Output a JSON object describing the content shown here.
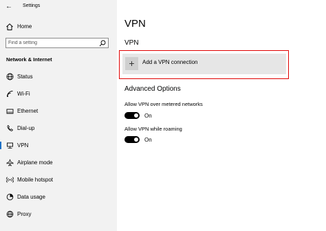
{
  "window": {
    "title": "Settings"
  },
  "sidebar": {
    "home_label": "Home",
    "search": {
      "placeholder": "Find a setting"
    },
    "section_title": "Network & Internet",
    "items": [
      {
        "label": "Status"
      },
      {
        "label": "Wi-Fi"
      },
      {
        "label": "Ethernet"
      },
      {
        "label": "Dial-up"
      },
      {
        "label": "VPN"
      },
      {
        "label": "Airplane mode"
      },
      {
        "label": "Mobile hotspot"
      },
      {
        "label": "Data usage"
      },
      {
        "label": "Proxy"
      }
    ],
    "active_item": "VPN",
    "accent_color": "#1b6fc5"
  },
  "main": {
    "page_title": "VPN",
    "subheading": "VPN",
    "add_vpn": {
      "label": "Add a VPN connection"
    },
    "highlight_color": "#e00000",
    "advanced_title": "Advanced Options",
    "options": [
      {
        "label": "Allow VPN over metered networks",
        "state": "On"
      },
      {
        "label": "Allow VPN while roaming",
        "state": "On"
      }
    ]
  }
}
